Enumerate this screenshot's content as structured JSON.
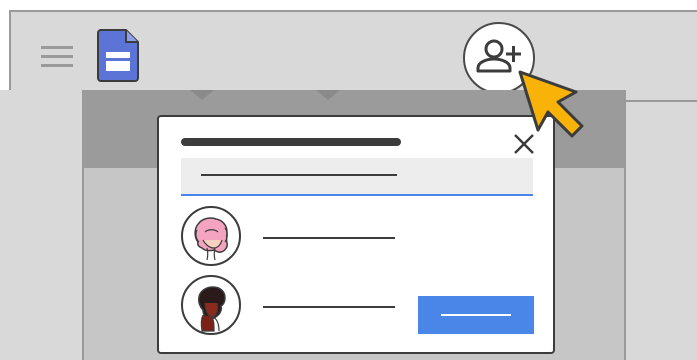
{
  "app": {
    "menu_icon": "hamburger-menu-icon",
    "doc_icon": "document-icon",
    "doc_icon_color": "#5b74d6"
  },
  "toolbar": {
    "share_icon": "add-person-icon",
    "share_label": ""
  },
  "dialog": {
    "title": "",
    "close_icon": "close-icon",
    "search": {
      "value": "",
      "placeholder": ""
    },
    "people": [
      {
        "name": "",
        "avatar_icon": "avatar-pink-hair"
      },
      {
        "name": "",
        "avatar_icon": "avatar-dark-hair"
      }
    ],
    "send_label": "",
    "accent_color": "#4a86e8"
  },
  "cursor": {
    "icon": "pointer-cursor-icon",
    "color": "#f9b208"
  }
}
